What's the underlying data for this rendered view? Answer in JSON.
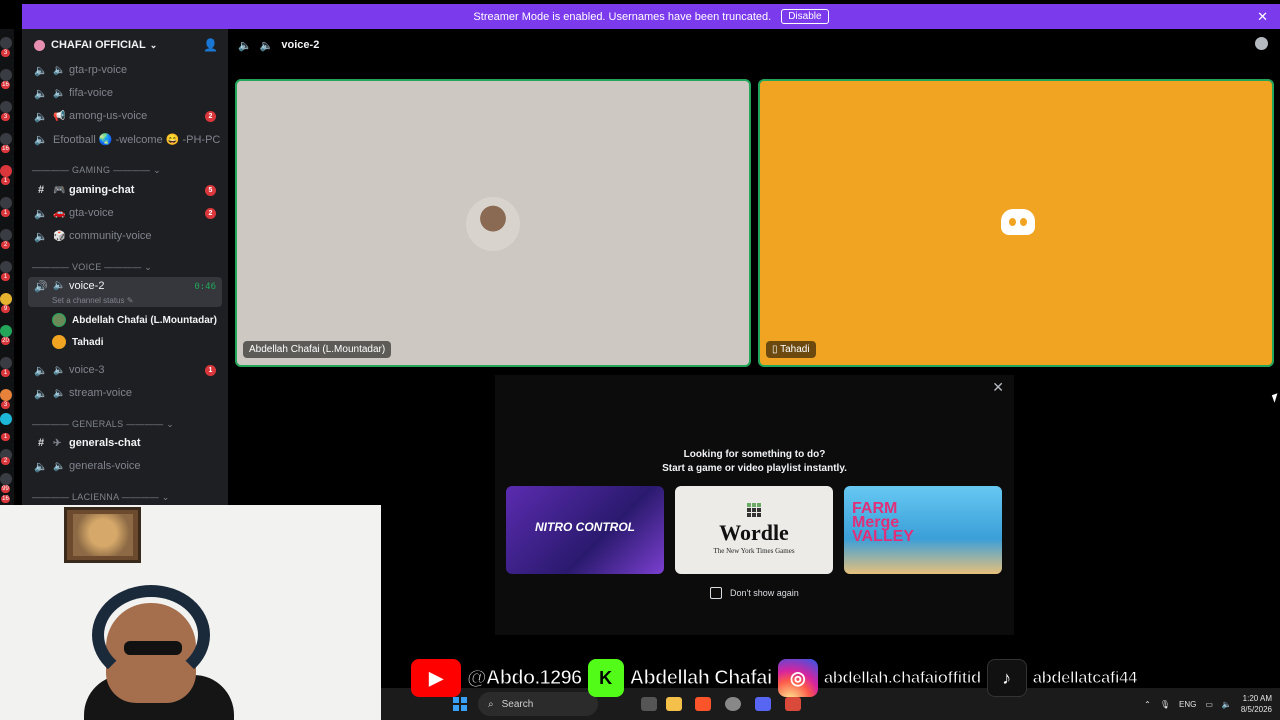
{
  "banner": {
    "text": "Streamer Mode is enabled. Usernames have been truncated.",
    "button": "Disable",
    "close": "✕"
  },
  "rail": {
    "badges": [
      "3",
      "16",
      "3",
      "16",
      "1",
      "1",
      "2",
      "1",
      "9",
      "20",
      "1",
      "3",
      "1",
      "2",
      "99",
      "16"
    ]
  },
  "server": {
    "name": "CHAFAI OFFICIAL"
  },
  "channels": {
    "gta_rp_voice": "gta-rp-voice",
    "fifa_voice": "fifa-voice",
    "among_us_voice": "among-us-voice",
    "among_us_badge": "2",
    "efootball": "Efootball 🌏 -welcome 😄 -PH-PC",
    "cat_gaming": "———— GAMING ———— ⌄",
    "gaming_chat": "gaming-chat",
    "gaming_chat_badge": "5",
    "gta_voice": "gta-voice",
    "gta_voice_badge": "2",
    "community_voice": "community-voice",
    "cat_voice": "———— VOICE ———— ⌄",
    "voice2": "voice-2",
    "voice2_time": "0:46",
    "voice2_status": "Set a channel status ✎",
    "member1": "Abdellah Chafai (L.Mountadar)",
    "member2": "Tahadi",
    "voice3": "voice-3",
    "voice3_badge": "1",
    "stream_voice": "stream-voice",
    "cat_generals": "———— GENERALS ———— ⌄",
    "generals_chat": "generals-chat",
    "generals_voice": "generals-voice",
    "cat_lacienna": "———— LACIENNA ———— ⌄"
  },
  "call": {
    "channel": "voice-2",
    "participant1": "Abdellah Chafai (L.Mountadar)",
    "participant2": "Tahadi",
    "participant2_icon": "phone-icon"
  },
  "activity": {
    "close": "✕",
    "line1": "Looking for something to do?",
    "line2": "Start a game or video playlist instantly.",
    "card1": "NITRO CONTROL",
    "card2": "Wordle",
    "card2_sub": "The New York Times Games",
    "card3": "FARM Merge VALLEY",
    "dont_show": "Don't show again"
  },
  "social": {
    "youtube": "@Abdo.1296",
    "kick": "Abdellah Chafai",
    "instagram": "abdellah.chafaioffitid",
    "tiktok": "abdellatcafi44"
  },
  "taskbar": {
    "search": "Search",
    "lang": "ENG",
    "time": "1:20 AM",
    "date": "8/5/2026"
  },
  "colors": {
    "banner": "#7c3aed",
    "speaking_border": "#23a55a",
    "tile2_bg": "#f0a422",
    "badge": "#da373c"
  }
}
